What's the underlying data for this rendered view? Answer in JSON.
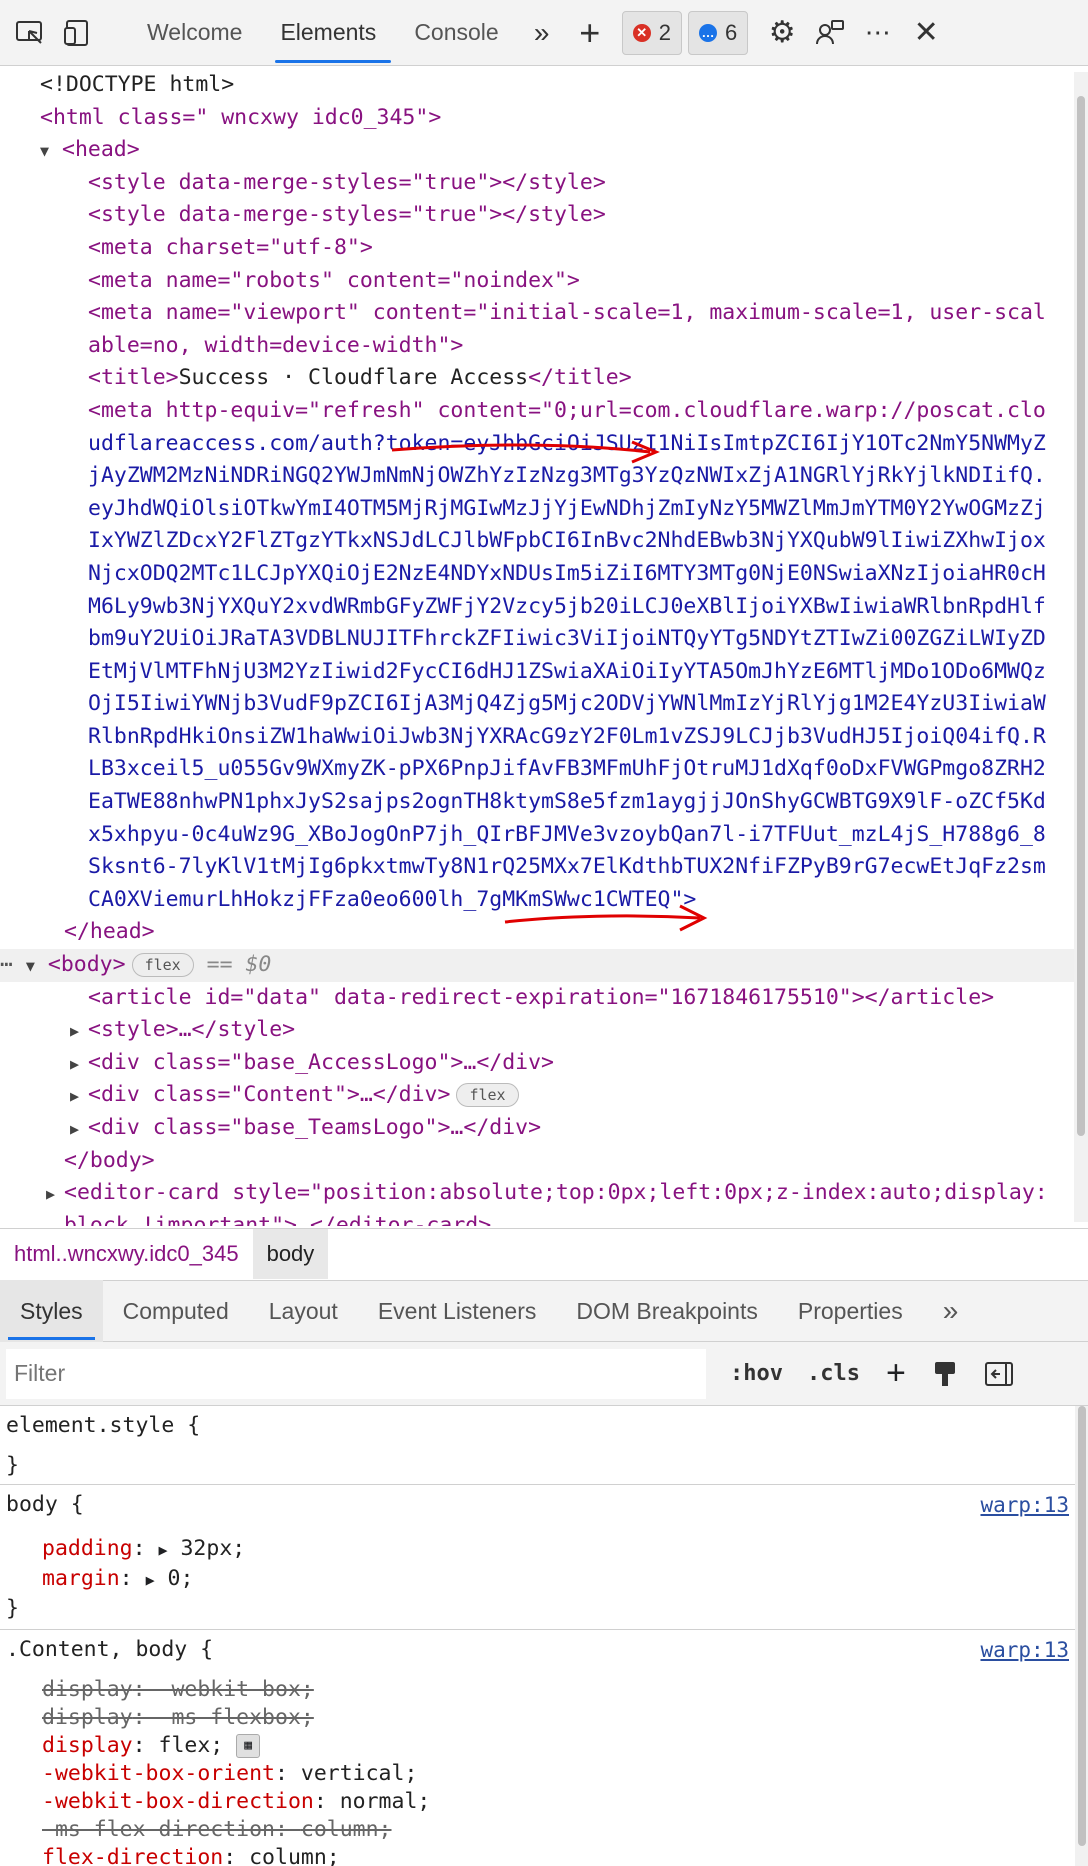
{
  "toolbar": {
    "tabs": [
      "Welcome",
      "Elements",
      "Console"
    ],
    "errors": "2",
    "messages": "6"
  },
  "dom": {
    "doctype": "<!DOCTYPE html>",
    "html_open": "<html class=\" wncxwy idc0_345\">",
    "head_open": "<head>",
    "style1": "<style data-merge-styles=\"true\"></style>",
    "style2": "<style data-merge-styles=\"true\"></style>",
    "meta_charset": "<meta charset=\"utf-8\">",
    "meta_robots": "<meta name=\"robots\" content=\"noindex\">",
    "meta_viewport_1": "<meta name=\"viewport\" content=\"initial-scale=1, maximum-scale=1, user-scal",
    "meta_viewport_2": "able=no, width=device-width\">",
    "title_open": "<title>",
    "title_text": "Success · Cloudflare Access",
    "title_close": "</title>",
    "refresh_lines": [
      "<meta http-equiv=\"refresh\" content=\"0;url=com.cloudflare.warp://poscat.clo",
      "udflareaccess.com/auth?token=eyJhbGciOiJSUzI1NiIsImtpZCI6IjY1OTc2NmY5NWMyZ",
      "jAyZWM2MzNiNDRiNGQ2YWJmNmNjOWZhYzIzNzg3MTg3YzQzNWIxZjA1NGRlYjRkYjlkNDIifQ.",
      "eyJhdWQiOlsiOTkwYmI4OTM5MjRjMGIwMzJjYjEwNDhjZmIyNzY5MWZlMmJmYTM0Y2YwOGMzZj",
      "IxYWZlZDcxY2FlZTgzYTkxNSJdLCJlbWFpbCI6InBvc2NhdEBwb3NjYXQubW9lIiwiZXhwIjox",
      "NjcxODQ2MTc1LCJpYXQiOjE2NzE4NDYxNDUsIm5iZiI6MTY3MTg0NjE0NSwiaXNzIjoiaHR0cH",
      "M6Ly9wb3NjYXQuY2xvdWRmbGFyZWFjY2Vzcy5jb20iLCJ0eXBlIjoiYXBwIiwiaWRlbnRpdHlf",
      "bm9uY2UiOiJRaTA3VDBLNUJITFhrckZFIiwic3ViIjoiNTQyYTg5NDYtZTIwZi00ZGZiLWIyZD",
      "EtMjVlMTFhNjU3M2YzIiwid2FycCI6dHJ1ZSwiaXAiOiIyYTA5OmJhYzE6MTljMDo1ODo6MWQz",
      "OjI5IiwiYWNjb3VudF9pZCI6IjA3MjQ4Zjg5Mjc2ODVjYWNlMmIzYjRlYjg1M2E4YzU3IiwiaW",
      "RlbnRpdHkiOnsiZW1haWwiOiJwb3NjYXRAcG9zY2F0Lm1vZSJ9LCJjb3VudHJ5IjoiQ04ifQ.R",
      "LB3xceil5_u055Gv9WXmyZK-pPX6PnpJifAvFB3MFmUhFjOtruMJ1dXqf0oDxFVWGPmgo8ZRH2",
      "EaTWE88nhwPN1phxJyS2sajps2ognTH8ktymS8e5fzm1aygjjJOnShyGCWBTG9X9lF-oZCf5Kd",
      "x5xhpyu-0c4uWz9G_XBoJogOnP7jh_QIrBFJMVe3vzoybQan7l-i7TFUut_mzL4jS_H788g6_8",
      "Sksnt6-7lyKlV1tMjIg6pkxtmwTy8N1rQ25MXx7ElKdthbTUX2NfiFZPyB9rG7ecwEtJqFz2sm",
      "CA0XViemurLhHokzjFFza0eo600lh_7gMKmSWwc1CWTEQ\">"
    ],
    "head_close": "</head>",
    "body_open": "<body>",
    "body_pill": "flex",
    "body_eq": "== $0",
    "article": "<article id=\"data\" data-redirect-expiration=\"1671846175510\"></article>",
    "style_collapsed": "<style>…</style>",
    "div_accesslogo": "<div class=\"base_AccessLogo\">…</div>",
    "div_content": "<div class=\"Content\">…</div>",
    "div_content_pill": "flex",
    "div_teamslogo": "<div class=\"base_TeamsLogo\">…</div>",
    "body_close": "</body>",
    "editor_card_1": "<editor-card style=\"position:absolute;top:0px;left:0px;z-index:auto;display:",
    "editor_card_2": "block !important\">…</editor-card>"
  },
  "breadcrumb": [
    "html..wncxwy.idc0_345",
    "body"
  ],
  "style_tabs": [
    "Styles",
    "Computed",
    "Layout",
    "Event Listeners",
    "DOM Breakpoints",
    "Properties"
  ],
  "filter": {
    "placeholder": "Filter",
    "hov": ":hov",
    "cls": ".cls"
  },
  "styles": {
    "element_style_open": "element.style {",
    "close_brace": "}",
    "body_rule": {
      "selector": "body {",
      "source": "warp:13",
      "props": [
        {
          "name": "padding",
          "value": "32px;"
        },
        {
          "name": "margin",
          "value": "0;"
        }
      ]
    },
    "content_rule": {
      "selector": ".Content, body {",
      "source": "warp:13",
      "props": [
        {
          "name": "display",
          "value": "-webkit-box;",
          "struck": true
        },
        {
          "name": "display",
          "value": "-ms-flexbox;",
          "struck": true
        },
        {
          "name": "display",
          "value": "flex;",
          "struck": false
        },
        {
          "name": "-webkit-box-orient",
          "value": "vertical;",
          "struck": false
        },
        {
          "name": "-webkit-box-direction",
          "value": "normal;",
          "struck": false
        },
        {
          "name": "-ms-flex-direction",
          "value": "column;",
          "struck": true
        },
        {
          "name": "flex-direction",
          "value": "column;",
          "struck": false
        }
      ]
    }
  },
  "colors": {
    "annotation_arrow": "#e00000",
    "tab_accent": "#1a73e8"
  }
}
